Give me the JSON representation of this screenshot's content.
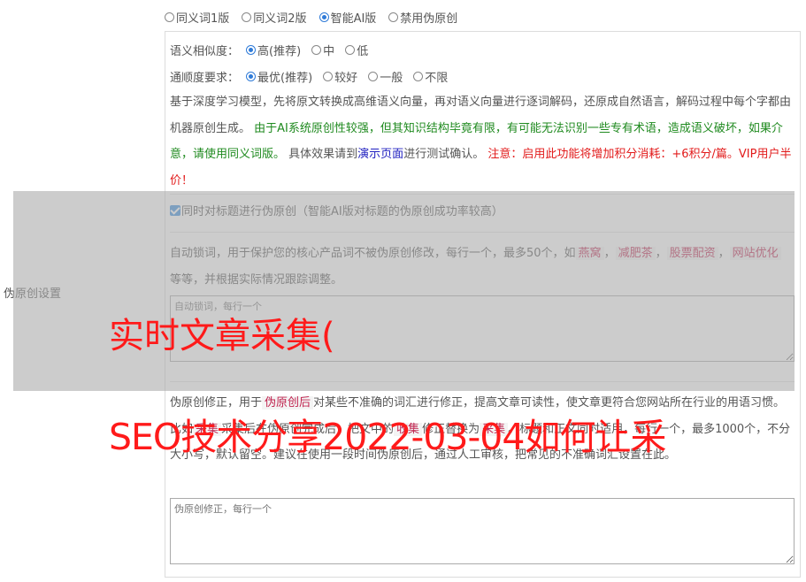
{
  "side_label": "伪原创设置",
  "mode_options": [
    {
      "label": "同义词1版",
      "checked": false
    },
    {
      "label": "同义词2版",
      "checked": false
    },
    {
      "label": "智能AI版",
      "checked": true
    },
    {
      "label": "禁用伪原创",
      "checked": false
    }
  ],
  "similarity": {
    "label": "语义相似度：",
    "options": [
      {
        "label": "高(推荐)",
        "checked": true
      },
      {
        "label": "中",
        "checked": false
      },
      {
        "label": "低",
        "checked": false
      }
    ]
  },
  "fluency": {
    "label": "通顺度要求：",
    "options": [
      {
        "label": "最优(推荐)",
        "checked": true
      },
      {
        "label": "较好",
        "checked": false
      },
      {
        "label": "一般",
        "checked": false
      },
      {
        "label": "不限",
        "checked": false
      }
    ]
  },
  "desc": {
    "p1": "基于深度学习模型，先将原文转换成高维语义向量，再对语义向量进行逐词解码，还原成自然语言，解码过程中每个字都由机器原创生成。",
    "p2_green": "由于AI系统原创性较强，但其知识结构毕竟有限，有可能无法识别一些专有术语，造成语义破坏，如果介意，请使用同义词版。",
    "p3_a": "具体效果请到",
    "p3_link": "演示页面",
    "p3_b": "进行测试确认。",
    "p4_red": "注意：启用此功能将增加积分消耗：+6积分/篇。VIP用户半价！"
  },
  "title_checkbox": {
    "label": "同时对标题进行伪原创（智能AI版对标题的伪原创成功率较高）",
    "checked": true
  },
  "lock": {
    "text_a": "自动锁词，用于保护您的核心产品词不被伪原创修改，每行一个，最多50个，如",
    "tags": [
      "燕窝",
      "减肥茶",
      "股票配资",
      "网站优化"
    ],
    "sep": "，",
    "text_b": "等等，并根据实际情况跟踪调整。",
    "placeholder": "自动锁词，每行一个"
  },
  "fix": {
    "text_a": "伪原创修正，用于",
    "tag1": "伪原创后",
    "text_b": "对某些不准确的词汇进行修正，提高文章可读性，使文章更符合您网站所在行业的用语习惯。比如",
    "tag2": "采集",
    "text_c": "采集后在伪原创完成后，把文中的",
    "tag3": "收集",
    "text_d": "修正替换为",
    "tag4": "采集",
    "text_e": "。标题和正文同时适用，每行一个，最多1000个，不分大小写，默认留空。建议在使用一段时间伪原创后，通过人工审核，把常见的不准确词汇设置在此。",
    "placeholder": "伪原创修正，每行一个"
  },
  "watermark": {
    "line1": "实时文章采集(",
    "line2": "SEO技术分享2022-03-04如何让采"
  }
}
